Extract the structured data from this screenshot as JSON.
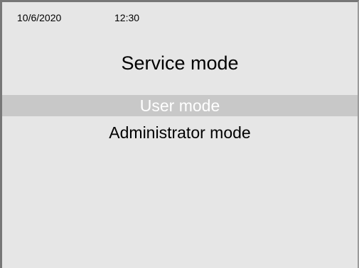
{
  "status_bar": {
    "date": "10/6/2020",
    "time": "12:30"
  },
  "header": {
    "title": "Service mode"
  },
  "menu": {
    "items": [
      {
        "label": "User mode",
        "selected": true
      },
      {
        "label": "Administrator mode",
        "selected": false
      }
    ]
  },
  "colors": {
    "screen_background": "#e6e6e6",
    "selection_background": "#c8c8c8",
    "selected_text": "#ffffff",
    "text": "#000000",
    "frame": "#777777"
  }
}
